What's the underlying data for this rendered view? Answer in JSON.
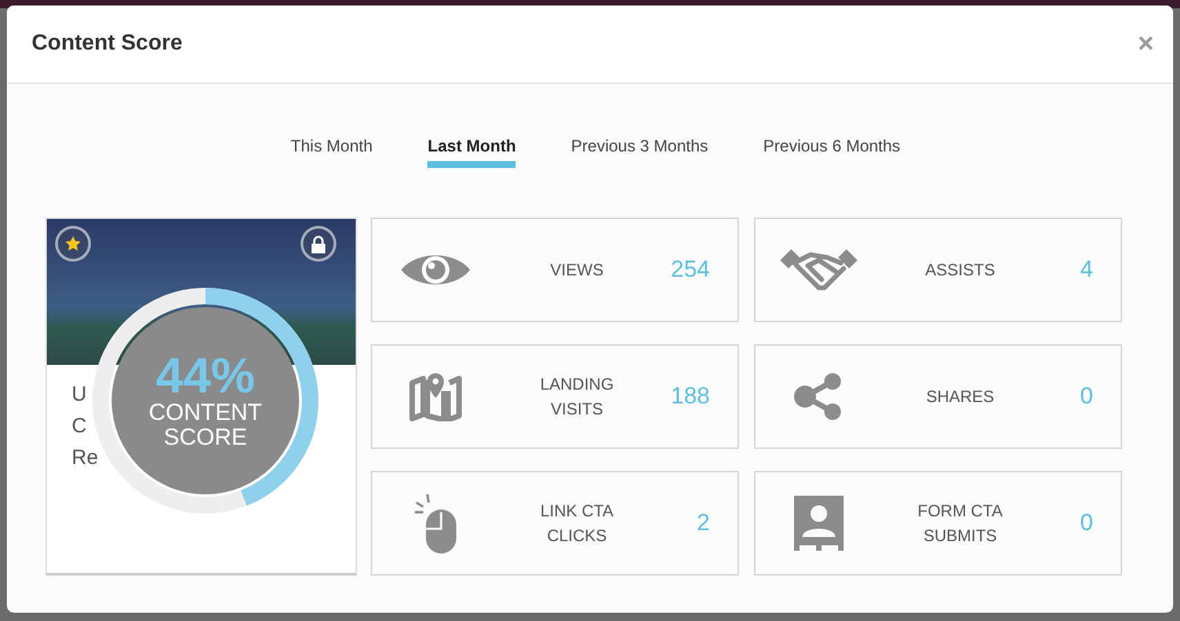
{
  "dialog": {
    "title": "Content Score",
    "close": "×"
  },
  "tabs": [
    {
      "label": "This Month",
      "selected": false
    },
    {
      "label": "Last Month",
      "selected": true
    },
    {
      "label": "Previous 3 Months",
      "selected": false
    },
    {
      "label": "Previous 6 Months",
      "selected": false
    }
  ],
  "content_card": {
    "title_lines": [
      "U",
      "C",
      "Re"
    ],
    "starred": true,
    "locked": true,
    "score": {
      "value": "44%",
      "label": "CONTENT SCORE",
      "level": 0.44
    }
  },
  "stats": [
    {
      "kind": "eye",
      "label": "VIEWS",
      "value": "254"
    },
    {
      "kind": "handshake",
      "label": "ASSISTS",
      "value": "4"
    },
    {
      "kind": "map",
      "label": "LANDING VISITS",
      "value": "188"
    },
    {
      "kind": "share",
      "label": "SHARES",
      "value": "0"
    },
    {
      "kind": "mouse",
      "label": "LINK CTA CLICKS",
      "value": "2"
    },
    {
      "kind": "contact",
      "label": "FORM CTA SUBMITS",
      "value": "0"
    }
  ]
}
